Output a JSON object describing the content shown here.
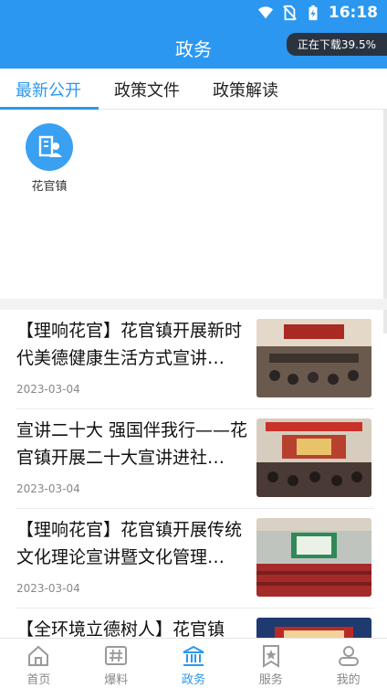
{
  "status_bar": {
    "time": "16:18"
  },
  "header": {
    "title": "政务",
    "download_status": "正在下载39.5%"
  },
  "tabs": [
    {
      "label": "最新公开",
      "active": true
    },
    {
      "label": "政策文件",
      "active": false
    },
    {
      "label": "政策解读",
      "active": false
    }
  ],
  "towns": [
    {
      "label": "花官镇"
    }
  ],
  "news": [
    {
      "title": "【理响花官】花官镇开展新时代美德健康生活方式宣讲…",
      "date": "2023-03-04"
    },
    {
      "title": "宣讲二十大 强国伴我行——花官镇开展二十大宣讲进社…",
      "date": "2023-03-04"
    },
    {
      "title": "【理响花官】花官镇开展传统文化理论宣讲暨文化管理…",
      "date": "2023-03-04"
    },
    {
      "title": "【全环境立德树人】花官镇",
      "date": ""
    }
  ],
  "bottom_nav": [
    {
      "label": "首页",
      "icon": "home-icon",
      "active": false
    },
    {
      "label": "爆料",
      "icon": "hashtag-icon",
      "active": false
    },
    {
      "label": "政务",
      "icon": "government-building-icon",
      "active": true
    },
    {
      "label": "服务",
      "icon": "bookmark-star-icon",
      "active": false
    },
    {
      "label": "我的",
      "icon": "person-icon",
      "active": false
    }
  ],
  "colors": {
    "accent": "#2b97f0",
    "download_pill": "#2a3340"
  }
}
